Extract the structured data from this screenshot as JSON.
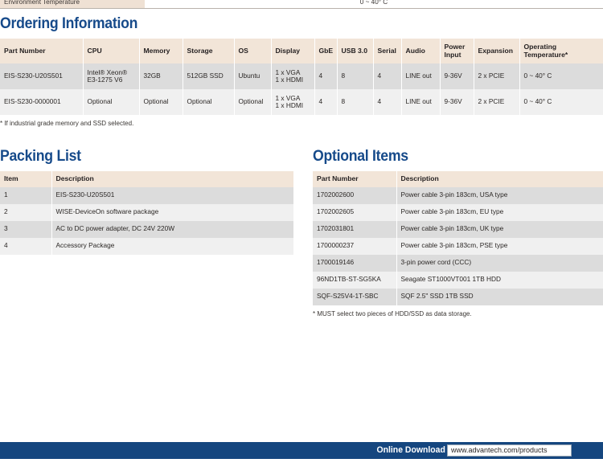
{
  "spec_strip": {
    "label": "Environment Temperature",
    "value": "0 ~ 40° C"
  },
  "ordering": {
    "title": "Ordering Information",
    "columns": [
      "Part Number",
      "CPU",
      "Memory",
      "Storage",
      "OS",
      "Display",
      "GbE",
      "USB 3.0",
      "Serial",
      "Audio",
      "Power Input",
      "Expansion",
      "Operating Temperature*"
    ],
    "rows": [
      {
        "part_number": "EIS-S230-U20S501",
        "cpu_line1": "Intel® Xeon®",
        "cpu_line2": "E3-1275 V6",
        "memory": "32GB",
        "storage": "512GB SSD",
        "os": "Ubuntu",
        "display_line1": "1 x VGA",
        "display_line2": "1 x HDMI",
        "gbe": "4",
        "usb3": "8",
        "serial": "4",
        "audio": "LINE out",
        "power_input": "9-36V",
        "expansion": "2 x PCIE",
        "operating_temperature": "0 ~ 40° C"
      },
      {
        "part_number": "EIS-S230-0000001",
        "cpu_line1": "Optional",
        "cpu_line2": "",
        "memory": "Optional",
        "storage": "Optional",
        "os": "Optional",
        "display_line1": "1 x VGA",
        "display_line2": "1 x HDMI",
        "gbe": "4",
        "usb3": "8",
        "serial": "4",
        "audio": "LINE out",
        "power_input": "9-36V",
        "expansion": "2 x PCIE",
        "operating_temperature": "0 ~ 40° C"
      }
    ],
    "footnote": "* If industrial grade memory and SSD selected."
  },
  "packing": {
    "title": "Packing List",
    "columns": [
      "Item",
      "Description"
    ],
    "rows": [
      {
        "item": "1",
        "description": "EIS-S230-U20S501"
      },
      {
        "item": "2",
        "description": "WISE-DeviceOn software package"
      },
      {
        "item": "3",
        "description": "AC to DC power adapter, DC 24V 220W"
      },
      {
        "item": "4",
        "description": "Accessory Package"
      }
    ]
  },
  "optional": {
    "title": "Optional Items",
    "columns": [
      "Part Number",
      "Description"
    ],
    "rows": [
      {
        "part_number": "1702002600",
        "description": "Power cable 3-pin 183cm, USA type"
      },
      {
        "part_number": "1702002605",
        "description": "Power cable 3-pin 183cm, EU type"
      },
      {
        "part_number": "1702031801",
        "description": "Power cable 3-pin 183cm, UK type"
      },
      {
        "part_number": "1700000237",
        "description": "Power cable 3-pin 183cm, PSE type"
      },
      {
        "part_number": "1700019146",
        "description": "3-pin power cord (CCC)"
      },
      {
        "part_number": "96ND1TB-ST-SG5KA",
        "description": "Seagate ST1000VT001 1TB HDD"
      },
      {
        "part_number": "SQF-S25V4-1T-SBC",
        "description": "SQF 2.5\" SSD 1TB SSD"
      }
    ],
    "footnote": "* MUST select two pieces of HDD/SSD as data storage."
  },
  "footer": {
    "download_label": "Online Download",
    "url": "www.advantech.com/products",
    "bar_color": "#15467f"
  }
}
